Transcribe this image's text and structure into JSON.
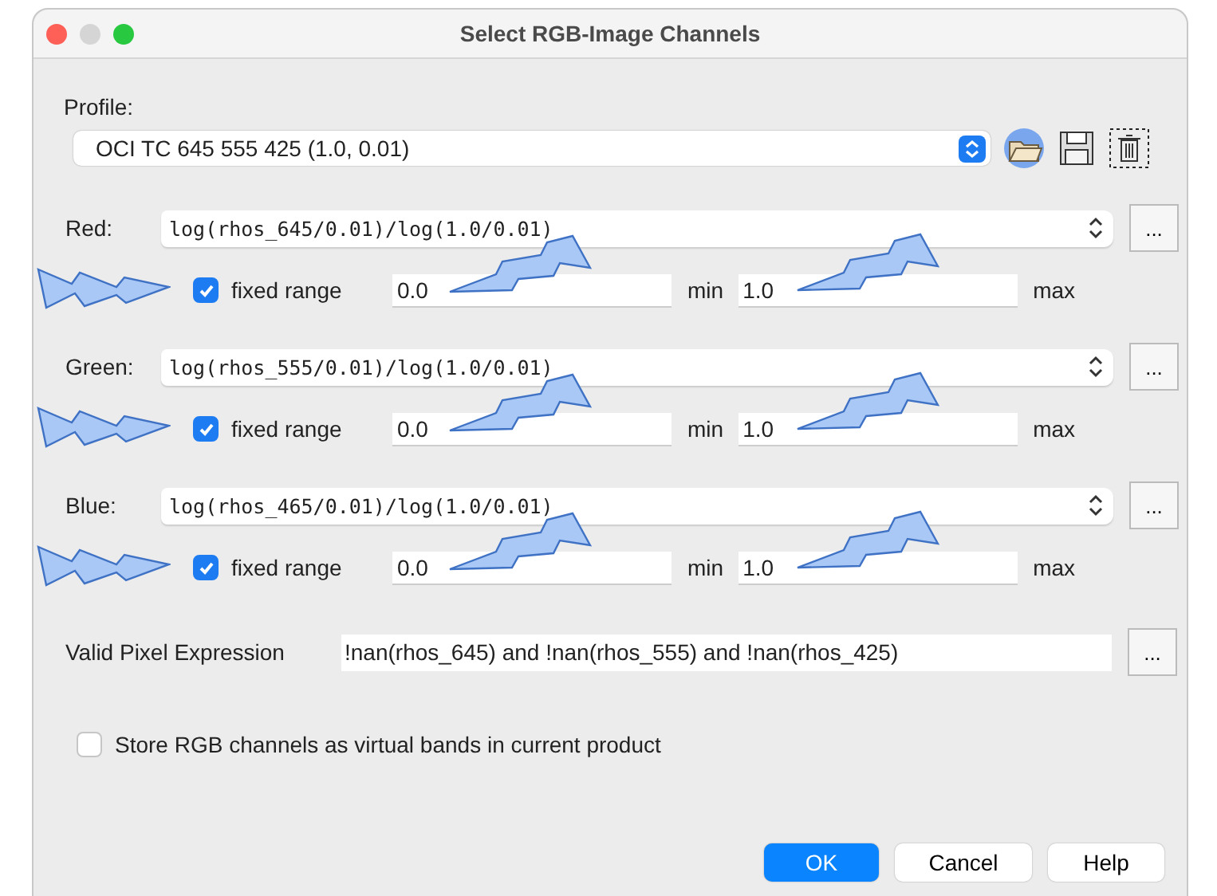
{
  "window": {
    "title": "Select RGB-Image Channels"
  },
  "profile": {
    "label": "Profile:",
    "value": "OCI TC 645 555 425 (1.0, 0.01)"
  },
  "channels": [
    {
      "label": "Red:",
      "expression": "log(rhos_645/0.01)/log(1.0/0.01)",
      "more": "...",
      "fixed_range": true,
      "fixed_range_label": "fixed range",
      "min": "0.0",
      "min_label": "min",
      "max": "1.0",
      "max_label": "max"
    },
    {
      "label": "Green:",
      "expression": "log(rhos_555/0.01)/log(1.0/0.01)",
      "more": "...",
      "fixed_range": true,
      "fixed_range_label": "fixed range",
      "min": "0.0",
      "min_label": "min",
      "max": "1.0",
      "max_label": "max"
    },
    {
      "label": "Blue:",
      "expression": "log(rhos_465/0.01)/log(1.0/0.01)",
      "more": "...",
      "fixed_range": true,
      "fixed_range_label": "fixed range",
      "min": "0.0",
      "min_label": "min",
      "max": "1.0",
      "max_label": "max"
    }
  ],
  "valid_pixel": {
    "label": "Valid Pixel Expression",
    "value": "!nan(rhos_645) and !nan(rhos_555) and !nan(rhos_425)",
    "more": "..."
  },
  "store_virtual": {
    "label": "Store RGB channels as virtual bands in current product",
    "checked": false
  },
  "buttons": [
    {
      "label": "OK",
      "kind": "primary"
    },
    {
      "label": "Cancel",
      "kind": "normal"
    },
    {
      "label": "Help",
      "kind": "normal"
    }
  ]
}
